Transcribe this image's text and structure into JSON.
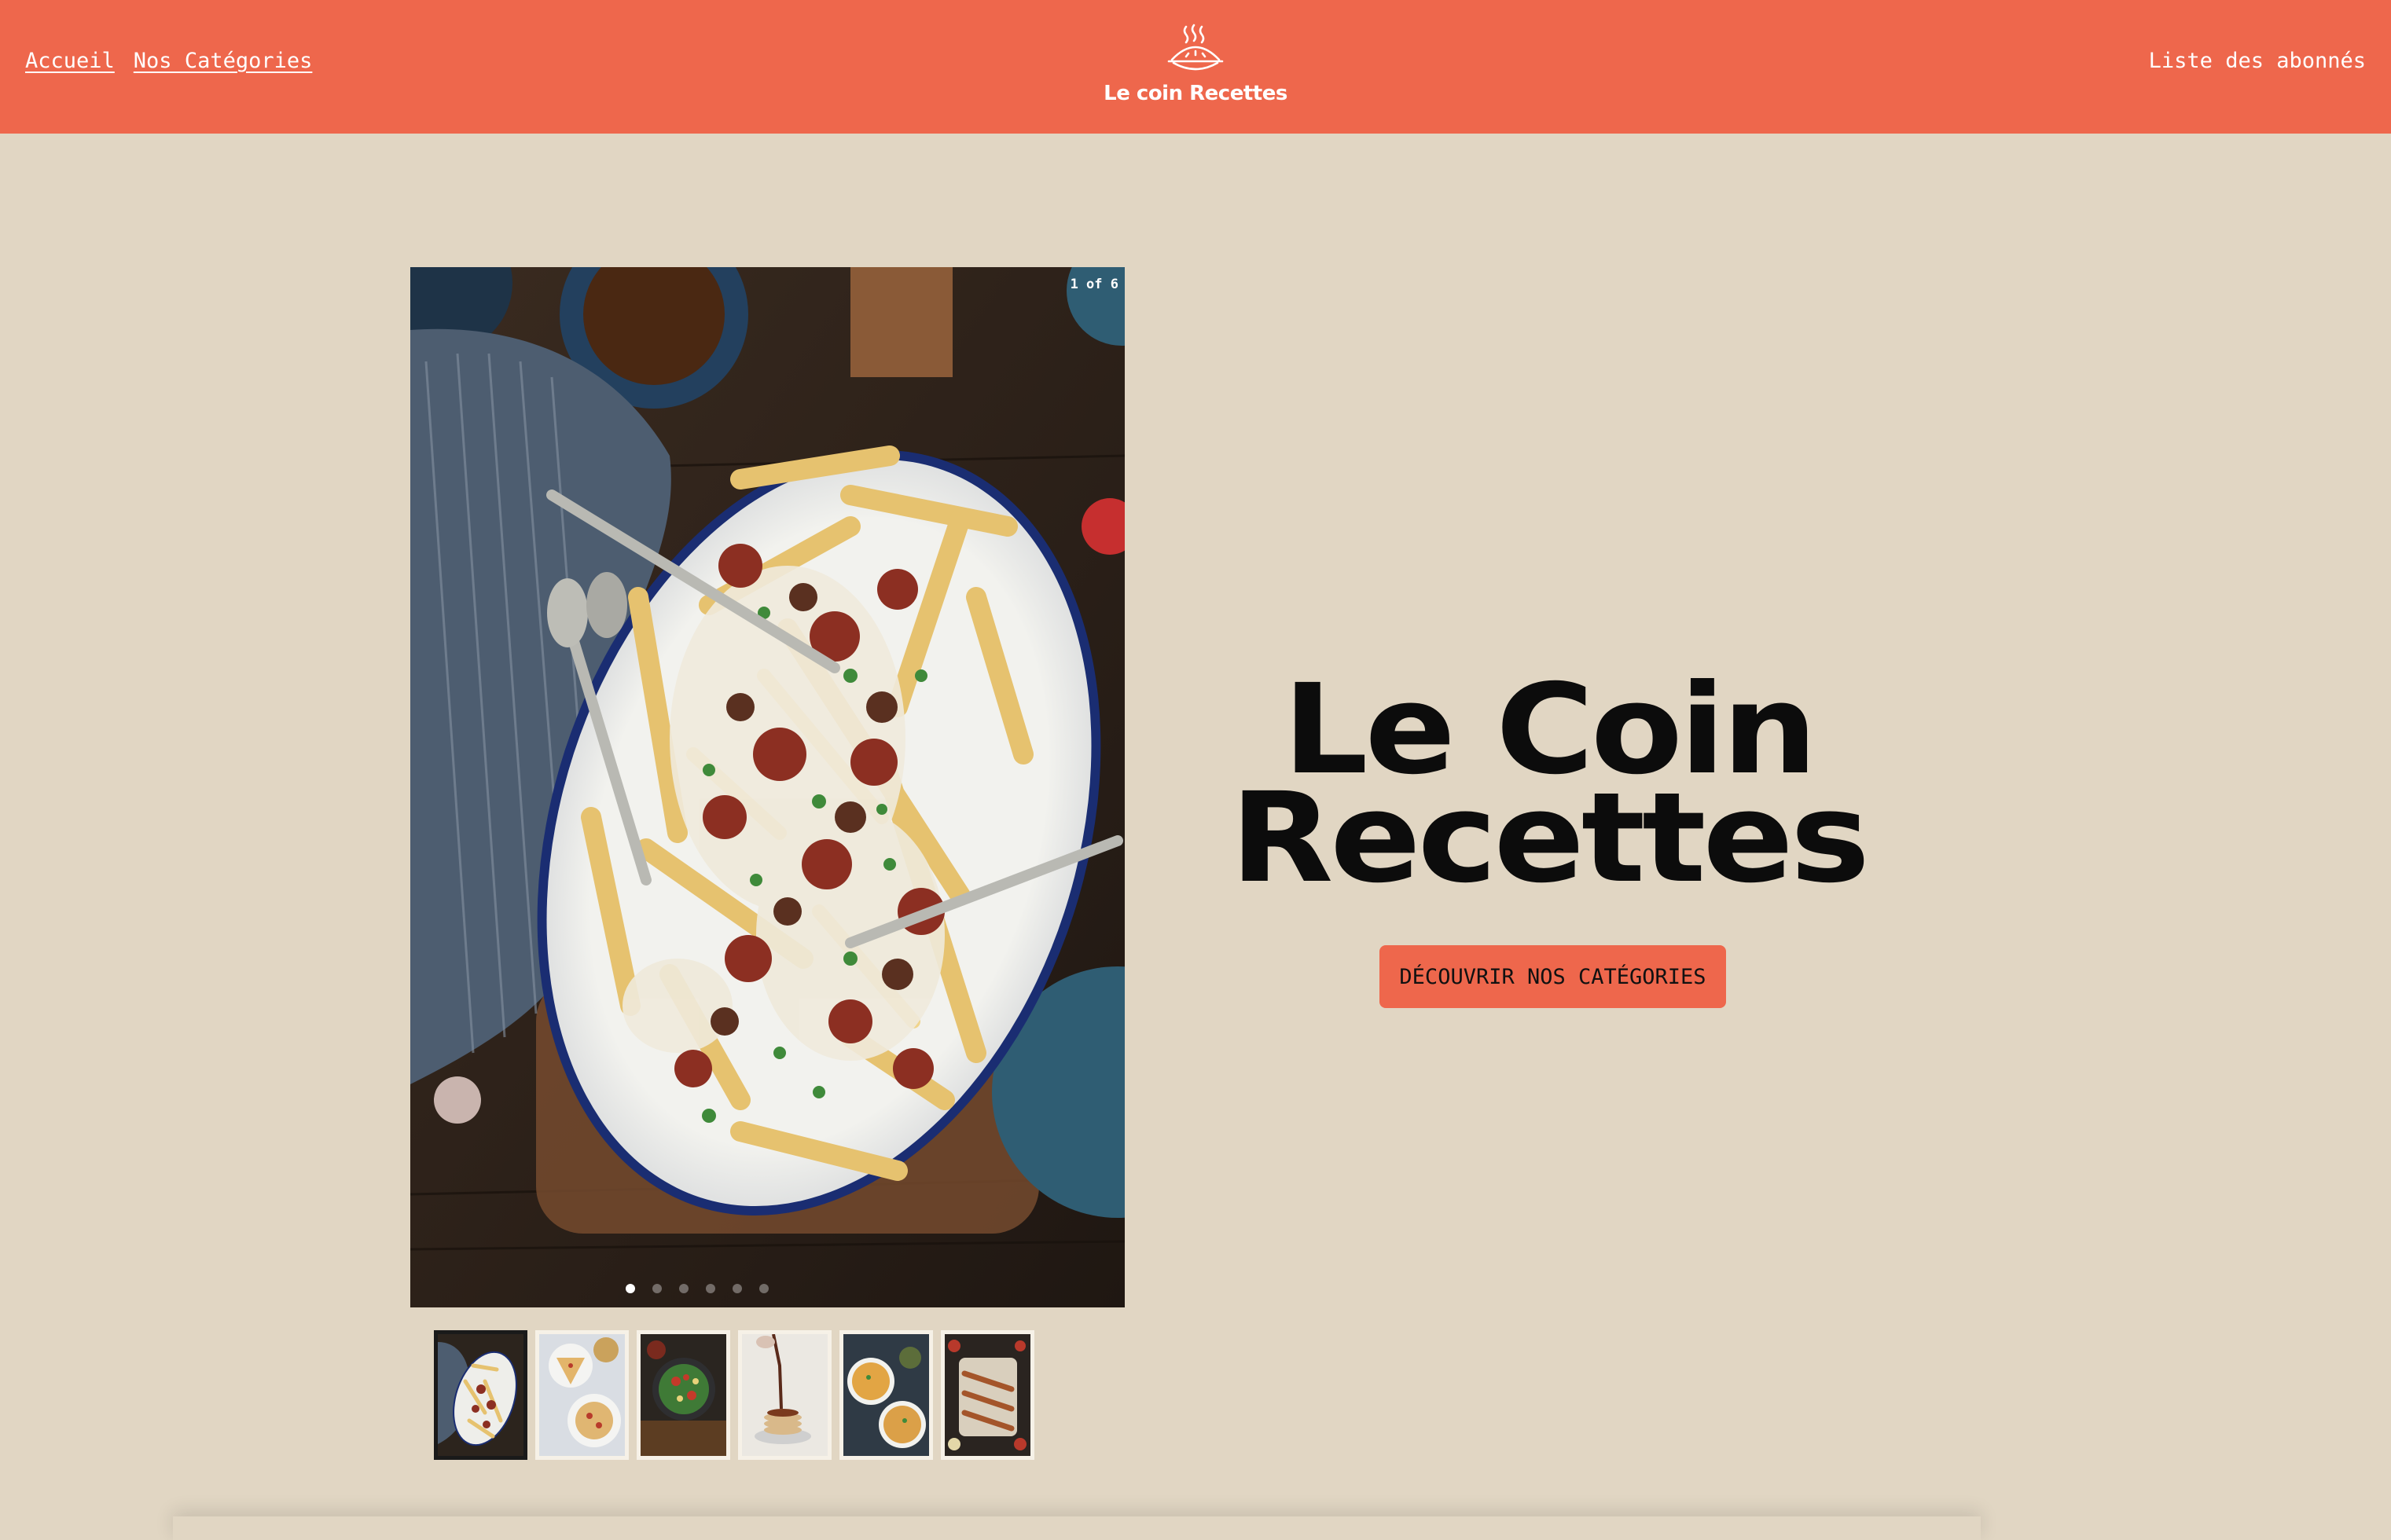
{
  "header": {
    "nav_left": [
      {
        "label": "Accueil"
      },
      {
        "label": "Nos Catégories"
      }
    ],
    "brand_name": "Le coin Recettes",
    "brand_icon": "pie-icon",
    "nav_right": "Liste des abonnés"
  },
  "carousel": {
    "counter": "1 of 6",
    "slide_count": 6,
    "active_index": 0,
    "thumbnails": [
      {
        "name": "poutine"
      },
      {
        "name": "pizza-plates"
      },
      {
        "name": "salad-bowl"
      },
      {
        "name": "pancakes-syrup"
      },
      {
        "name": "soup-bowls"
      },
      {
        "name": "skewers-platter"
      }
    ]
  },
  "hero": {
    "title_line1": "Le Coin",
    "title_line2": "Recettes",
    "cta_label": "DÉCOUVRIR NOS CATÉGORIES"
  },
  "colors": {
    "header_bg": "#ee674c",
    "page_bg": "#e1d6c3",
    "cta_bg": "#ee674c",
    "title": "#0c0c0c"
  }
}
